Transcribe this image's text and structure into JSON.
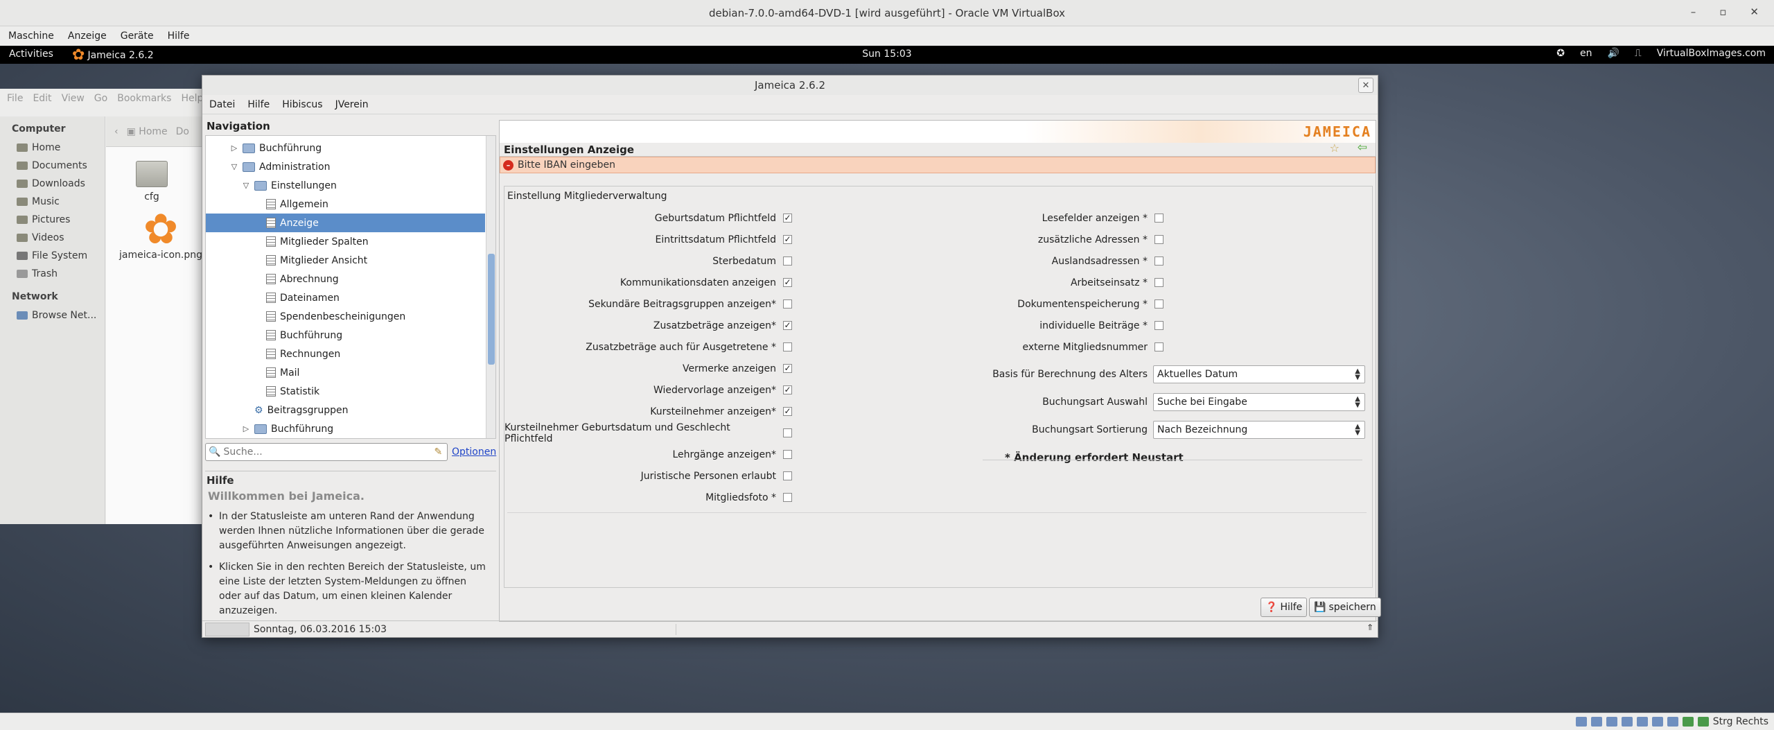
{
  "host": {
    "title": "debian-7.0.0-amd64-DVD-1 [wird ausgeführt] - Oracle VM VirtualBox",
    "menu": [
      "Maschine",
      "Anzeige",
      "Geräte",
      "Hilfe"
    ],
    "status_right": "Strg Rechts"
  },
  "guest": {
    "activities": "Activities",
    "app_name": "Jameica 2.6.2",
    "clock": "Sun 15:03",
    "lang": "en",
    "tray_text": "VirtualBoxImages.com"
  },
  "nautilus": {
    "menu": [
      "File",
      "Edit",
      "View",
      "Go",
      "Bookmarks",
      "Help"
    ],
    "sections": {
      "computer": "Computer",
      "network": "Network"
    },
    "places": [
      "Home",
      "Documents",
      "Downloads",
      "Music",
      "Pictures",
      "Videos",
      "File System",
      "Trash"
    ],
    "network_items": [
      "Browse Net..."
    ],
    "path": [
      "Home",
      "Do"
    ],
    "files": [
      "cfg",
      "jameica-icon.png"
    ]
  },
  "jameica": {
    "title": "Jameica 2.6.2",
    "menu": [
      "Datei",
      "Hilfe",
      "Hibiscus",
      "JVerein"
    ],
    "nav_heading": "Navigation",
    "tree": [
      {
        "label": "Buchführung",
        "level": 1,
        "expander": "right",
        "icon": "folder"
      },
      {
        "label": "Administration",
        "level": 1,
        "expander": "down",
        "icon": "folder"
      },
      {
        "label": "Einstellungen",
        "level": 2,
        "expander": "down",
        "icon": "folder"
      },
      {
        "label": "Allgemein",
        "level": 3,
        "icon": "page"
      },
      {
        "label": "Anzeige",
        "level": 3,
        "icon": "page",
        "selected": true
      },
      {
        "label": "Mitglieder Spalten",
        "level": 3,
        "icon": "page"
      },
      {
        "label": "Mitglieder Ansicht",
        "level": 3,
        "icon": "page"
      },
      {
        "label": "Abrechnung",
        "level": 3,
        "icon": "page"
      },
      {
        "label": "Dateinamen",
        "level": 3,
        "icon": "page"
      },
      {
        "label": "Spendenbescheinigungen",
        "level": 3,
        "icon": "page"
      },
      {
        "label": "Buchführung",
        "level": 3,
        "icon": "page"
      },
      {
        "label": "Rechnungen",
        "level": 3,
        "icon": "page"
      },
      {
        "label": "Mail",
        "level": 3,
        "icon": "page"
      },
      {
        "label": "Statistik",
        "level": 3,
        "icon": "page"
      },
      {
        "label": "Beitragsgruppen",
        "level": 2,
        "icon": "gear"
      },
      {
        "label": "Buchführung",
        "level": 2,
        "expander": "right",
        "icon": "folder"
      }
    ],
    "search_placeholder": "Suche...",
    "optionen": "Optionen",
    "help": {
      "heading": "Hilfe",
      "title": "Willkommen bei Jameica.",
      "items": [
        "In der Statusleiste am unteren Rand der Anwendung werden Ihnen nützliche Informationen über die gerade ausgeführten Anweisungen angezeigt.",
        "Klicken Sie in den rechten Bereich der Statusleiste, um eine Liste der letzten System-Meldungen zu öffnen oder auf das Datum, um einen kleinen Kalender anzuzeigen."
      ]
    },
    "logo": "JAMEICA",
    "page_title": "Einstellungen Anzeige",
    "error": "Bitte IBAN eingeben",
    "group_title": "Einstellung Mitgliederverwaltung",
    "left_options": [
      {
        "label": "Geburtsdatum Pflichtfeld",
        "checked": true
      },
      {
        "label": "Eintrittsdatum Pflichtfeld",
        "checked": true
      },
      {
        "label": "Sterbedatum",
        "checked": false
      },
      {
        "label": "Kommunikationsdaten anzeigen",
        "checked": true
      },
      {
        "label": "Sekundäre Beitragsgruppen anzeigen*",
        "checked": false
      },
      {
        "label": "Zusatzbeträge anzeigen*",
        "checked": true
      },
      {
        "label": "Zusatzbeträge auch für Ausgetretene *",
        "checked": false
      },
      {
        "label": "Vermerke anzeigen",
        "checked": true
      },
      {
        "label": "Wiedervorlage anzeigen*",
        "checked": true
      },
      {
        "label": "Kursteilnehmer anzeigen*",
        "checked": true
      },
      {
        "label": "Kursteilnehmer Geburtsdatum und Geschlecht Pflichtfeld",
        "checked": false
      },
      {
        "label": "Lehrgänge anzeigen*",
        "checked": false
      },
      {
        "label": "Juristische Personen erlaubt",
        "checked": false
      },
      {
        "label": "Mitgliedsfoto *",
        "checked": false
      }
    ],
    "right_options": [
      {
        "label": "Lesefelder anzeigen *",
        "checked": false
      },
      {
        "label": "zusätzliche Adressen *",
        "checked": false
      },
      {
        "label": "Auslandsadressen *",
        "checked": false
      },
      {
        "label": "Arbeitseinsatz *",
        "checked": false
      },
      {
        "label": "Dokumentenspeicherung *",
        "checked": false
      },
      {
        "label": "individuelle Beiträge *",
        "checked": false
      },
      {
        "label": "externe Mitgliedsnummer",
        "checked": false
      }
    ],
    "selects": [
      {
        "label": "Basis für Berechnung des Alters",
        "value": "Aktuelles Datum"
      },
      {
        "label": "Buchungsart Auswahl",
        "value": "Suche bei Eingabe"
      },
      {
        "label": "Buchungsart Sortierung",
        "value": "Nach Bezeichnung"
      }
    ],
    "restart_note": "* Änderung erfordert Neustart",
    "buttons": {
      "help": "Hilfe",
      "save": "speichern"
    },
    "status_date": "Sonntag, 06.03.2016 15:03"
  }
}
